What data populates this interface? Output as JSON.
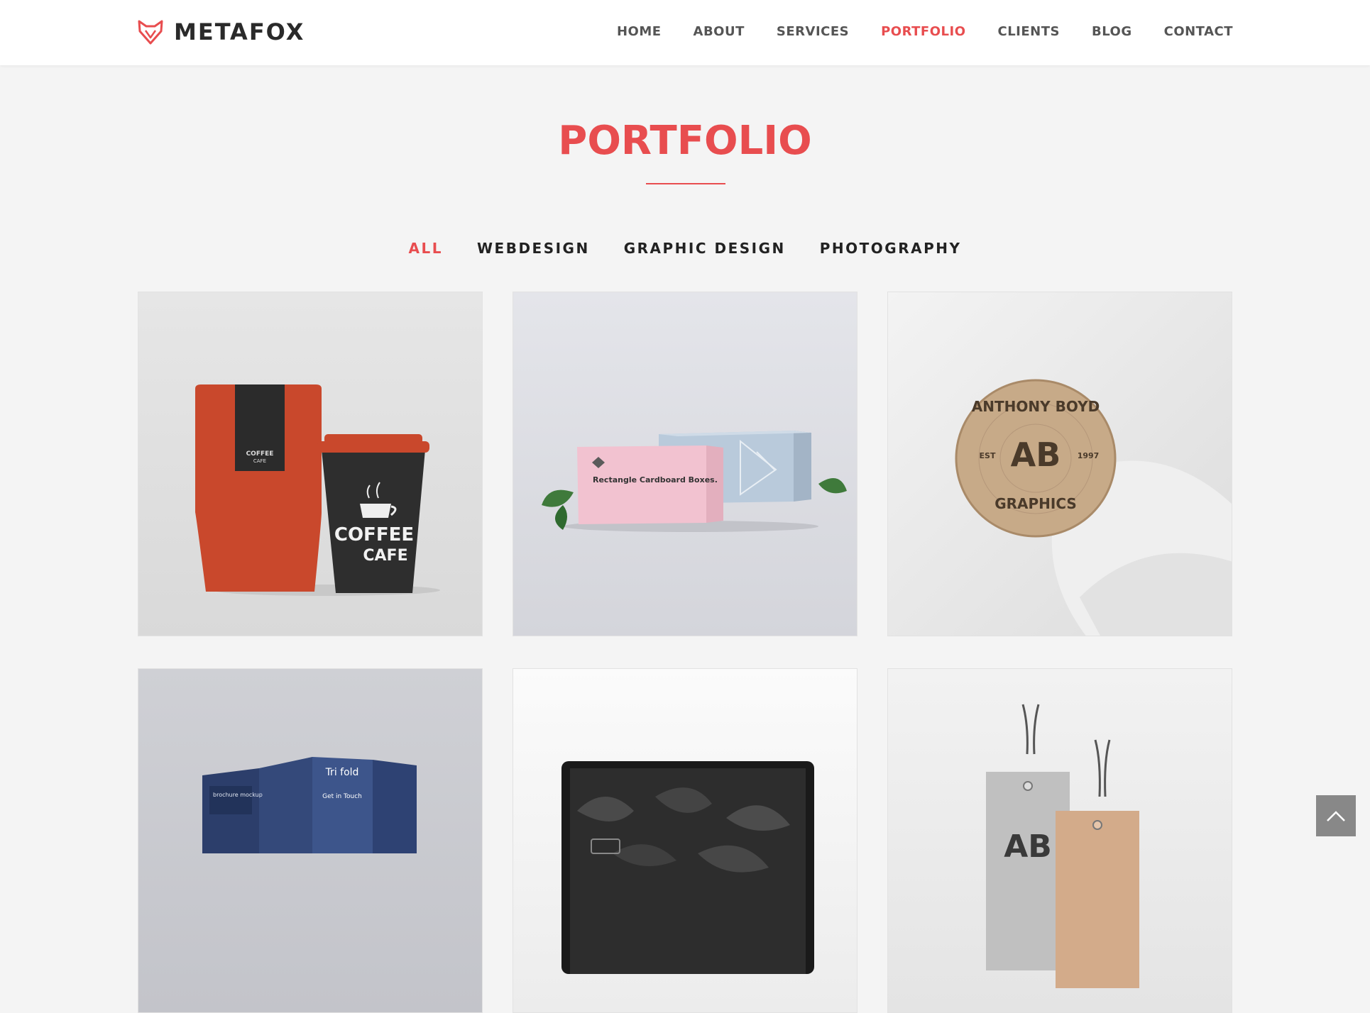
{
  "brand": {
    "name": "METAFOX",
    "accent": "#e84d4f"
  },
  "nav": {
    "items": [
      {
        "label": "HOME",
        "active": false
      },
      {
        "label": "ABOUT",
        "active": false
      },
      {
        "label": "SERVICES",
        "active": false
      },
      {
        "label": "PORTFOLIO",
        "active": true
      },
      {
        "label": "CLIENTS",
        "active": false
      },
      {
        "label": "BLOG",
        "active": false
      },
      {
        "label": "CONTACT",
        "active": false
      }
    ]
  },
  "section": {
    "title": "PORTFOLIO"
  },
  "filters": [
    {
      "label": "ALL",
      "active": true
    },
    {
      "label": "WEBDESIGN",
      "active": false
    },
    {
      "label": "GRAPHIC DESIGN",
      "active": false
    },
    {
      "label": "PHOTOGRAPHY",
      "active": false
    }
  ],
  "portfolio": {
    "items": [
      {
        "name": "coffee-packaging-mockup",
        "texts": [
          "COFFEE",
          "CAFE"
        ]
      },
      {
        "name": "cardboard-boxes-mockup",
        "texts": [
          "Rectangle Cardboard Boxes."
        ]
      },
      {
        "name": "wood-logo-mockup",
        "texts": [
          "ANTHONY BOYD",
          "GRAPHICS",
          "EST",
          "1997",
          "AB"
        ]
      },
      {
        "name": "trifold-brochure-mockup",
        "texts": [
          "Tri fold",
          "Get in Touch",
          "brochure mockup"
        ]
      },
      {
        "name": "laptop-screen-mockup",
        "texts": []
      },
      {
        "name": "hang-tag-mockup",
        "texts": [
          "AB"
        ]
      }
    ]
  },
  "scroll_top": {
    "icon": "chevron-up-icon"
  }
}
